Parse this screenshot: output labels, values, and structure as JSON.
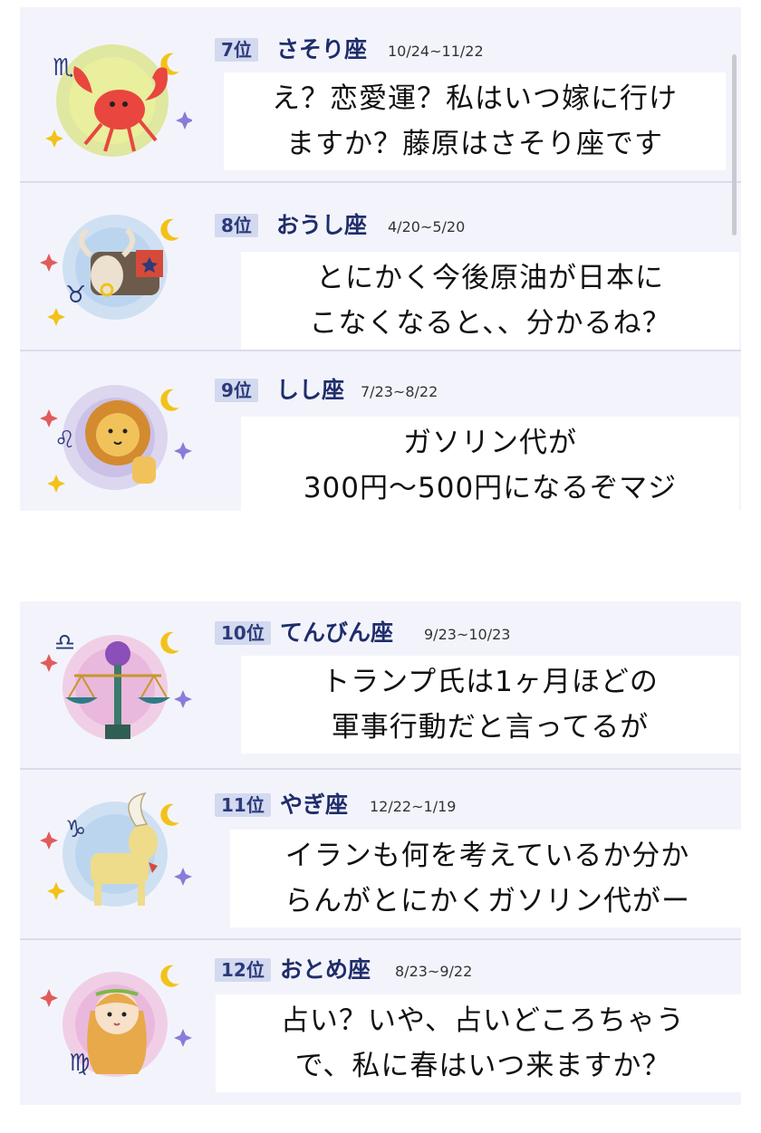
{
  "groups": [
    {
      "items": [
        {
          "rank": "7位",
          "sign": "さそり座",
          "dates": "10/24~11/22",
          "caption": [
            "え？恋愛運？私はいつ嫁に行け",
            "ますか？藤原はさそり座です"
          ]
        },
        {
          "rank": "8位",
          "sign": "おうし座",
          "dates": "4/20~5/20",
          "caption": [
            "とにかく今後原油が日本に",
            "こなくなると、、分かるね？"
          ]
        },
        {
          "rank": "9位",
          "sign": "しし座",
          "dates": "7/23~8/22",
          "caption": [
            "ガソリン代が",
            "300円〜500円になるぞマジ"
          ]
        }
      ]
    },
    {
      "items": [
        {
          "rank": "10位",
          "sign": "てんびん座",
          "dates": "9/23~10/23",
          "caption": [
            "トランプ氏は1ヶ月ほどの",
            "軍事行動だと言ってるが"
          ]
        },
        {
          "rank": "11位",
          "sign": "やぎ座",
          "dates": "12/22~1/19",
          "caption": [
            "イランも何を考えているか分か",
            "らんがとにかくガソリン代がー"
          ]
        },
        {
          "rank": "12位",
          "sign": "おとめ座",
          "dates": "8/23~9/22",
          "caption": [
            "占い？いや、占いどころちゃう",
            "で、私に春はいつ来ますか？"
          ]
        }
      ]
    }
  ],
  "colors": {
    "panel_bg": "#f3f4fb",
    "rank_bg": "#d3d9ef",
    "rank_text": "#2b3a7a",
    "sign_text": "#1f2d6b",
    "divider": "#d9dcec"
  },
  "icons": [
    "scorpio-icon",
    "taurus-icon",
    "leo-icon",
    "libra-icon",
    "capricorn-icon",
    "virgo-icon"
  ]
}
